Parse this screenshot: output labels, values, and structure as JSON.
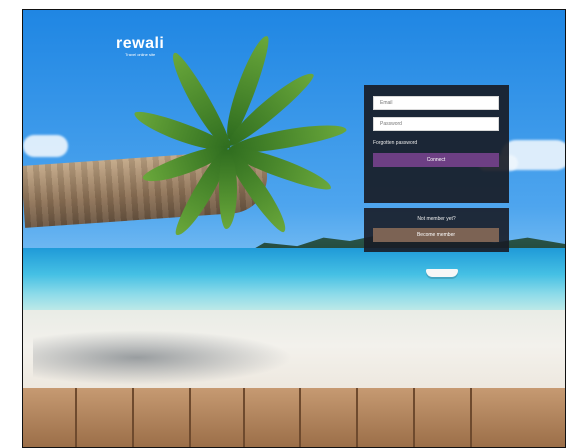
{
  "brand": {
    "name": "rewali",
    "tagline": "Travel online site"
  },
  "login": {
    "email_placeholder": "Email",
    "password_placeholder": "Password",
    "forgot_label": "Forgotten password",
    "connect_label": "Connect"
  },
  "signup": {
    "prompt": "Not member yet?",
    "button_label": "Become member"
  },
  "colors": {
    "connect_button": "#6d3f84",
    "become_button": "#7c6354",
    "panel_bg": "#181c26"
  }
}
